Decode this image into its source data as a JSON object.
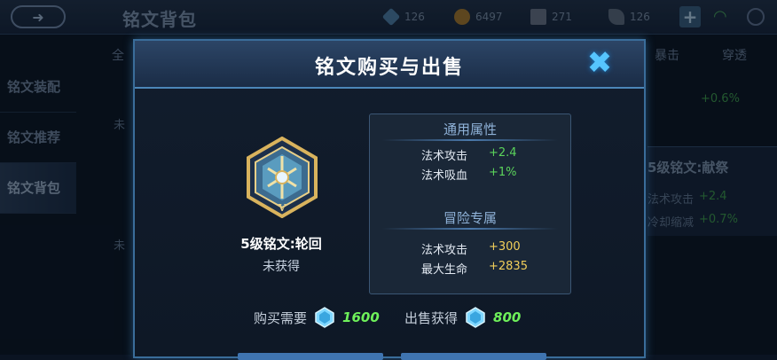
{
  "background": {
    "title": "铭文背包",
    "currencies": [
      {
        "value": "126",
        "icon": "diamond-icon"
      },
      {
        "value": "6497",
        "icon": "gold-coin-icon"
      },
      {
        "value": "271",
        "icon": "gem-icon"
      },
      {
        "value": "126",
        "icon": "feather-icon"
      }
    ],
    "sidebar": [
      "铭文装配",
      "铭文推荐",
      "铭文背包"
    ],
    "columns": [
      "全",
      "暴击",
      "穿透"
    ],
    "right_value_top": "+0.6%",
    "card": {
      "title": "5级铭文:献祭",
      "line1_label": "法术攻击",
      "line1_value": "+2.4",
      "line2_label": "冷却缩减",
      "line2_value": "+0.7%"
    },
    "left_faded": [
      "未",
      "未"
    ]
  },
  "modal": {
    "title": "铭文购买与出售",
    "close_icon": "close-icon",
    "rune": {
      "name": "5级铭文:轮回",
      "status": "未获得",
      "level_mark": "V"
    },
    "sections": [
      {
        "title": "通用属性",
        "rows": [
          {
            "label": "法术攻击",
            "value": "+2.4"
          },
          {
            "label": "法术吸血",
            "value": "+1%"
          }
        ]
      },
      {
        "title": "冒险专属",
        "rows": [
          {
            "label": "法术攻击",
            "value": "+300"
          },
          {
            "label": "最大生命",
            "value": "+2835"
          }
        ]
      }
    ],
    "buy": {
      "label": "购买需要",
      "value": "1600",
      "icon": "diamond-icon"
    },
    "sell": {
      "label": "出售获得",
      "value": "800",
      "icon": "diamond-icon"
    }
  },
  "colors": {
    "accent": "#56c5ff",
    "general_attr_value": "#5bd35b",
    "adventure_attr_value": "#f2cf5a",
    "price_value": "#6ef05a"
  }
}
